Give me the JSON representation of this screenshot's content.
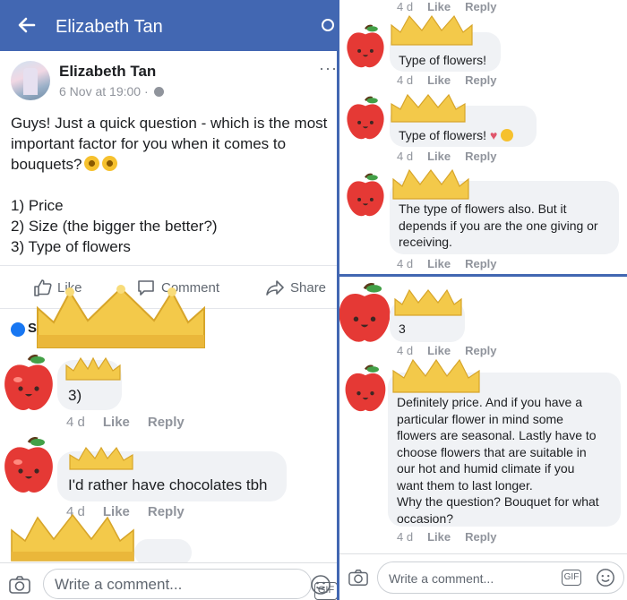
{
  "left": {
    "header": {
      "title": "Elizabeth Tan"
    },
    "post": {
      "author": "Elizabeth Tan",
      "time": "6 Nov at 19:00 · ",
      "more": "···",
      "body": [
        "Guys! Just a quick question - which is the most",
        "important factor for you when it comes to",
        "bouquets?"
      ],
      "list": [
        "1) Price",
        "2) Size (the bigger the better?)",
        "3) Type of flowers"
      ]
    },
    "actions": {
      "like": "Like",
      "comment": "Comment",
      "share": "Share"
    },
    "reactions_label": "S",
    "comments": [
      {
        "text": "3)",
        "time": "4 d",
        "like": "Like",
        "reply": "Reply"
      },
      {
        "text": "I'd rather have chocolates tbh",
        "time": "4 d",
        "like": "Like",
        "reply": "Reply"
      }
    ],
    "composer": {
      "placeholder": "Write a comment...",
      "gif": "GIF"
    }
  },
  "right": {
    "top_meta": {
      "time": "4 d",
      "like": "Like",
      "reply": "Reply"
    },
    "comments": [
      {
        "lines": [
          "Type of flowers!"
        ],
        "time": "4 d",
        "like": "Like",
        "reply": "Reply"
      },
      {
        "lines": [
          "Type of flowers!"
        ],
        "time": "4 d",
        "like": "Like",
        "reply": "Reply"
      },
      {
        "lines": [
          "The type of flowers also. But it",
          "depends if you are the one giving or",
          "receiving."
        ],
        "time": "4 d",
        "like": "Like",
        "reply": "Reply"
      },
      {
        "lines": [
          "3"
        ],
        "time": "4 d",
        "like": "Like",
        "reply": "Reply"
      },
      {
        "lines": [
          "Definitely price. And if you have a",
          "particular flower in mind some",
          "flowers are seasonal. Lastly have to",
          "choose flowers that are suitable in",
          "our hot and humid climate if you",
          "want them to last longer.",
          "Why the question? Bouquet for what",
          "occasion?"
        ],
        "time": "4 d",
        "like": "Like",
        "reply": "Reply"
      }
    ],
    "composer": {
      "placeholder": "Write a comment...",
      "gif": "GIF"
    }
  },
  "colors": {
    "facebook_blue": "#4267b2",
    "bubble_gray": "#f0f2f5",
    "meta_gray": "#90949c",
    "crown_gold": "#f3c94a",
    "apple_red": "#e53935"
  }
}
